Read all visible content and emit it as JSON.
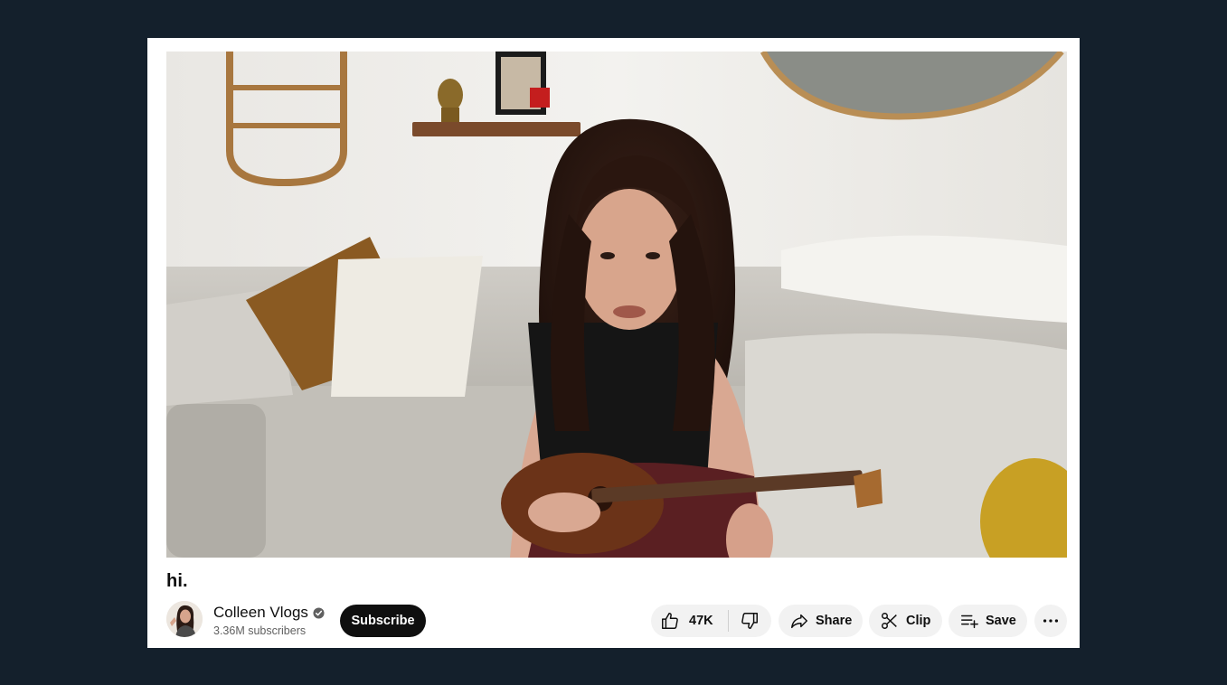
{
  "video": {
    "title": "hi."
  },
  "channel": {
    "name": "Colleen Vlogs",
    "subscribers": "3.36M subscribers",
    "verified_icon": "verified-check-icon"
  },
  "actions": {
    "subscribe_label": "Subscribe",
    "like_count": "47K",
    "share_label": "Share",
    "clip_label": "Clip",
    "save_label": "Save"
  },
  "icons": {
    "like": "thumbs-up-icon",
    "dislike": "thumbs-down-icon",
    "share": "share-arrow-icon",
    "clip": "scissors-icon",
    "save": "playlist-add-icon",
    "more": "more-horizontal-icon"
  },
  "colors": {
    "page_background": "#14202c",
    "subscribe_button": "#0f0f0f",
    "pill_background": "#f2f2f2"
  }
}
